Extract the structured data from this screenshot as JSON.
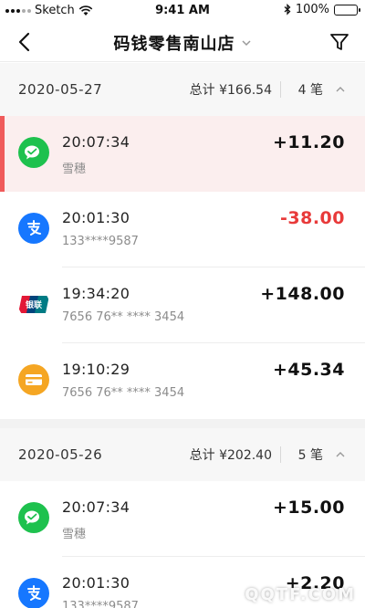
{
  "status_bar": {
    "carrier": "Sketch",
    "time": "9:41 AM",
    "battery": "100%"
  },
  "nav": {
    "title": "码钱零售南山店"
  },
  "groups": [
    {
      "date": "2020-05-27",
      "total": "总计 ¥166.54",
      "count": "4 笔",
      "transactions": [
        {
          "method": "wechat-pay",
          "time": "20:07:34",
          "sub": "雪穗",
          "amount": "+11.20",
          "highlighted": true
        },
        {
          "method": "alipay",
          "time": "20:01:30",
          "sub": "133****9587",
          "amount": "-38.00",
          "negative": true
        },
        {
          "method": "unionpay",
          "time": "19:34:20",
          "sub": "7656 76** **** 3454",
          "amount": "+148.00"
        },
        {
          "method": "bank-card",
          "time": "19:10:29",
          "sub": "7656 76** **** 3454",
          "amount": "+45.34"
        }
      ]
    },
    {
      "date": "2020-05-26",
      "total": "总计 ¥202.40",
      "count": "5 笔",
      "transactions": [
        {
          "method": "wechat-pay",
          "time": "20:07:34",
          "sub": "雪穗",
          "amount": "+15.00"
        },
        {
          "method": "alipay",
          "time": "20:01:30",
          "sub": "133****9587",
          "amount": "+2.20"
        }
      ]
    }
  ],
  "unionpay_logo_text": "银联",
  "watermark": "QQTF.COM",
  "colors": {
    "negative": "#e83a3a",
    "highlight_bar": "#f05a5a",
    "wechat": "#1ec14e",
    "alipay": "#1677ff",
    "bank_card": "#f5a623"
  }
}
